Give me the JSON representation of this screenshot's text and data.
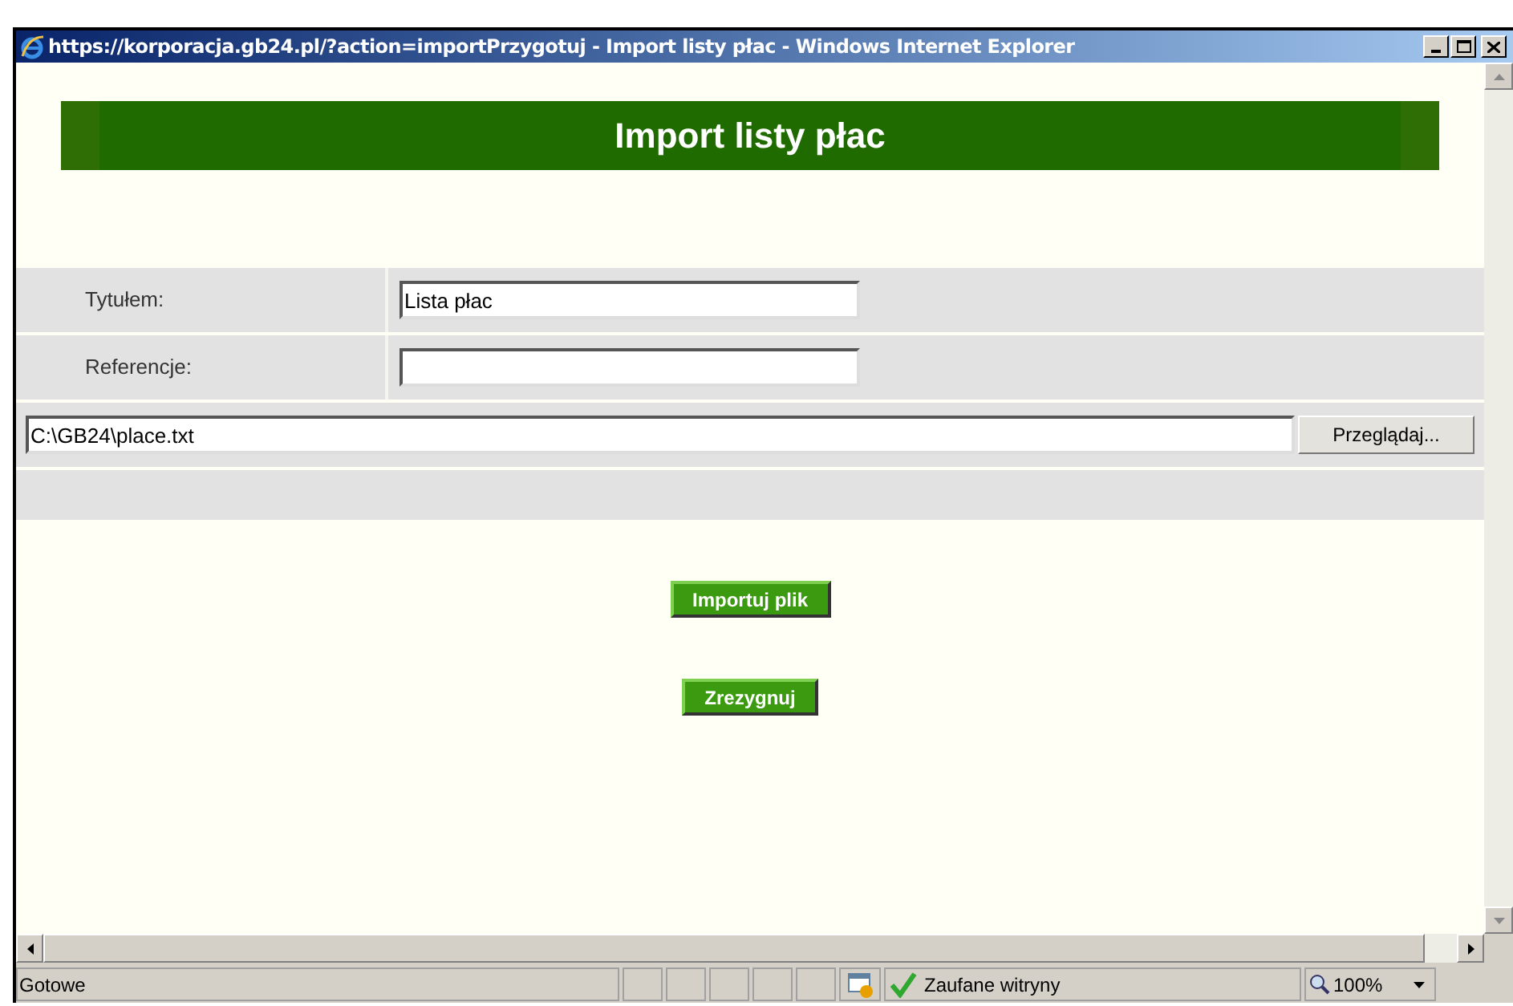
{
  "window": {
    "title": "https://korporacja.gb24.pl/?action=importPrzygotuj - Import listy płac - Windows Internet Explorer"
  },
  "page": {
    "heading": "Import listy płac",
    "fields": [
      {
        "label": "Tytułem:",
        "value": "Lista płac"
      },
      {
        "label": "Referencje:"
      }
    ],
    "file": {
      "value": "C:\\GB24\\place.txt",
      "browse": "Przeglądaj..."
    },
    "buttons": [
      "Importuj plik",
      "Zrezygnuj"
    ]
  },
  "status_bar": {
    "text": "Gotowe",
    "zone": "Zaufane witryny",
    "zoom": "100%"
  }
}
